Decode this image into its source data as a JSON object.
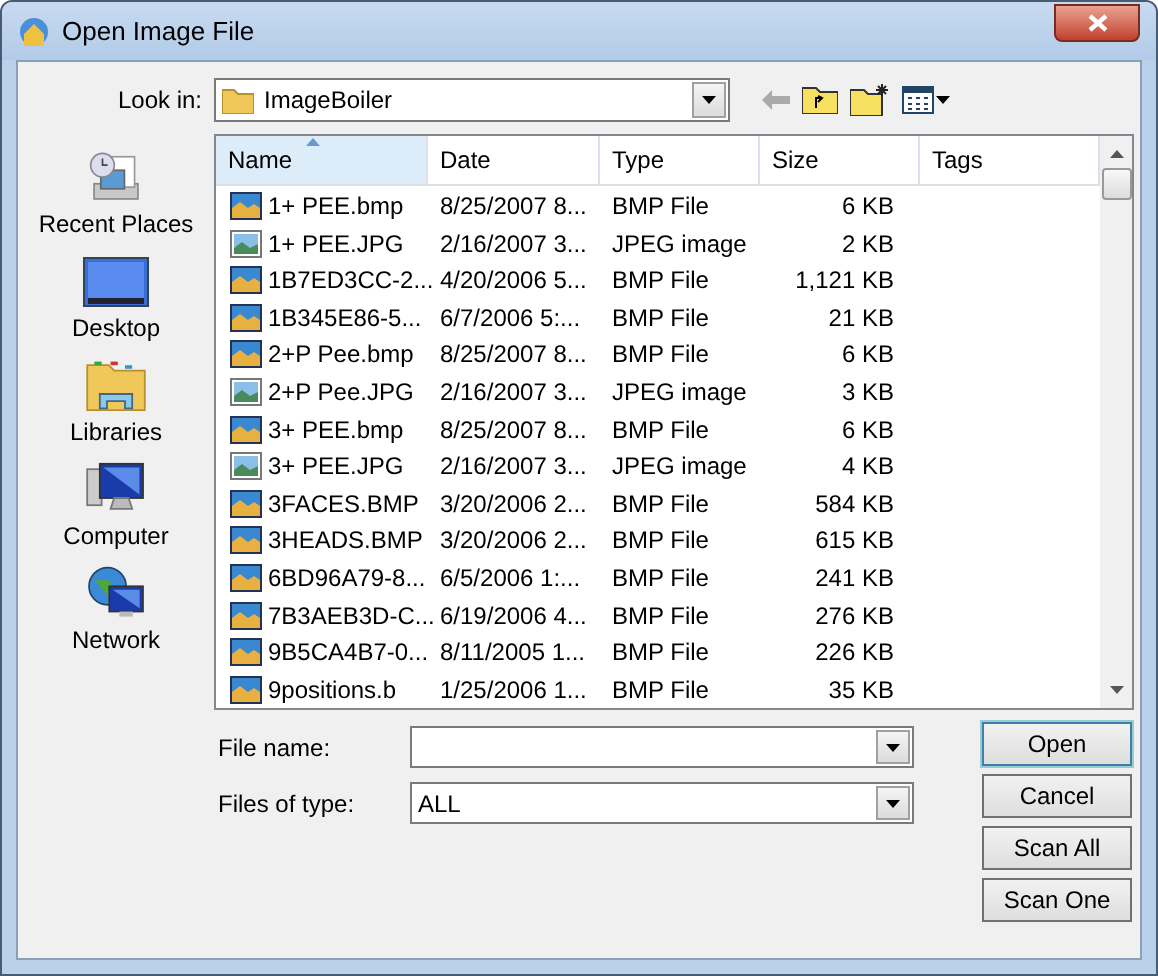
{
  "window": {
    "title": "Open Image File"
  },
  "look_in": {
    "label": "Look in:",
    "value": "ImageBoiler"
  },
  "places": [
    {
      "label": "Recent Places",
      "kind": "recent"
    },
    {
      "label": "Desktop",
      "kind": "desktop"
    },
    {
      "label": "Libraries",
      "kind": "libraries"
    },
    {
      "label": "Computer",
      "kind": "computer"
    },
    {
      "label": "Network",
      "kind": "network"
    }
  ],
  "table": {
    "columns": [
      {
        "label": "Name",
        "sorted": true
      },
      {
        "label": "Date",
        "sorted": false
      },
      {
        "label": "Type",
        "sorted": false
      },
      {
        "label": "Size",
        "sorted": false
      },
      {
        "label": "Tags",
        "sorted": false
      }
    ],
    "rows": [
      {
        "kind": "bmp",
        "name": "1+ PEE.bmp",
        "date": "8/25/2007 8...",
        "type": "BMP File",
        "size": "6 KB"
      },
      {
        "kind": "jpg",
        "name": "1+ PEE.JPG",
        "date": "2/16/2007 3...",
        "type": "JPEG image",
        "size": "2 KB"
      },
      {
        "kind": "bmp",
        "name": "1B7ED3CC-2...",
        "date": "4/20/2006 5...",
        "type": "BMP File",
        "size": "1,121 KB"
      },
      {
        "kind": "bmp",
        "name": "1B345E86-5...",
        "date": "6/7/2006 5:...",
        "type": "BMP File",
        "size": "21 KB"
      },
      {
        "kind": "bmp",
        "name": "2+P Pee.bmp",
        "date": "8/25/2007 8...",
        "type": "BMP File",
        "size": "6 KB"
      },
      {
        "kind": "jpg",
        "name": "2+P Pee.JPG",
        "date": "2/16/2007 3...",
        "type": "JPEG image",
        "size": "3 KB"
      },
      {
        "kind": "bmp",
        "name": "3+ PEE.bmp",
        "date": "8/25/2007 8...",
        "type": "BMP File",
        "size": "6 KB"
      },
      {
        "kind": "jpg",
        "name": "3+ PEE.JPG",
        "date": "2/16/2007 3...",
        "type": "JPEG image",
        "size": "4 KB"
      },
      {
        "kind": "bmp",
        "name": "3FACES.BMP",
        "date": "3/20/2006 2...",
        "type": "BMP File",
        "size": "584 KB"
      },
      {
        "kind": "bmp",
        "name": "3HEADS.BMP",
        "date": "3/20/2006 2...",
        "type": "BMP File",
        "size": "615 KB"
      },
      {
        "kind": "bmp",
        "name": "6BD96A79-8...",
        "date": "6/5/2006 1:...",
        "type": "BMP File",
        "size": "241 KB"
      },
      {
        "kind": "bmp",
        "name": "7B3AEB3D-C...",
        "date": "6/19/2006 4...",
        "type": "BMP File",
        "size": "276 KB"
      },
      {
        "kind": "bmp",
        "name": "9B5CA4B7-0...",
        "date": "8/11/2005 1...",
        "type": "BMP File",
        "size": "226 KB"
      },
      {
        "kind": "bmp",
        "name": "9positions.b",
        "date": "1/25/2006 1...",
        "type": "BMP File",
        "size": "35 KB"
      }
    ]
  },
  "file_name": {
    "label": "File name:"
  },
  "file_type": {
    "label": "Files of type:",
    "value": "ALL"
  },
  "buttons": [
    "Open",
    "Cancel",
    "Scan All",
    "Scan One"
  ]
}
